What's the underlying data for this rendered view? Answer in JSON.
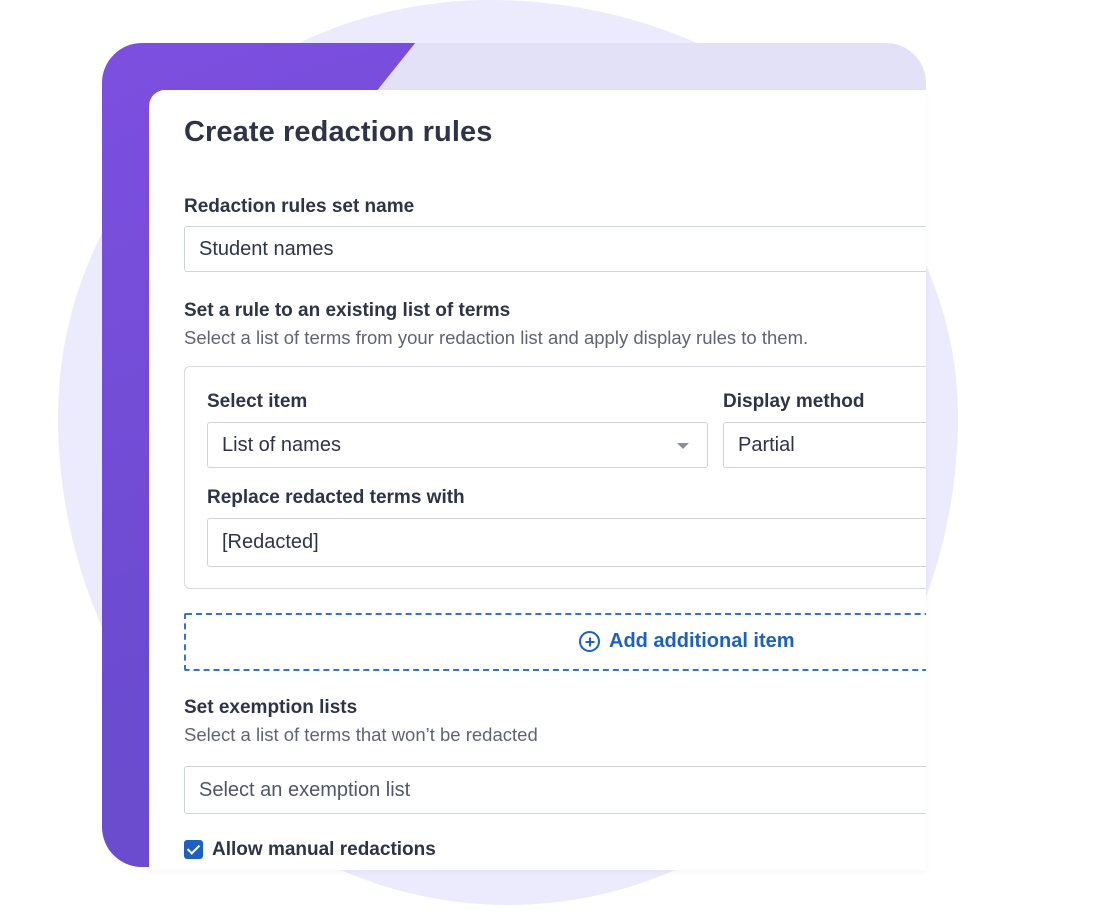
{
  "title": "Create redaction rules",
  "rules_set": {
    "label": "Redaction rules set name",
    "value": "Student names"
  },
  "existing_list": {
    "label": "Set a rule to an existing list of terms",
    "hint": "Select a list of terms from your redaction list and apply display rules to them."
  },
  "rule_item": {
    "select_label": "Select item",
    "select_value": "List of names",
    "display_label": "Display method",
    "display_value": "Partial",
    "replace_label": "Replace redacted terms with",
    "replace_value": "[Redacted]"
  },
  "add_item": {
    "label": "Add additional item",
    "icon": "plus-circle-icon"
  },
  "exemption": {
    "label": "Set exemption lists",
    "hint": "Select a list of terms that won’t be redacted",
    "placeholder": "Select an exemption list"
  },
  "manual": {
    "label": "Allow manual redactions",
    "checked": true
  },
  "colors": {
    "accent": "#1d5fc4",
    "purple": "#6b4bcf",
    "lavender": "#eceafd"
  }
}
